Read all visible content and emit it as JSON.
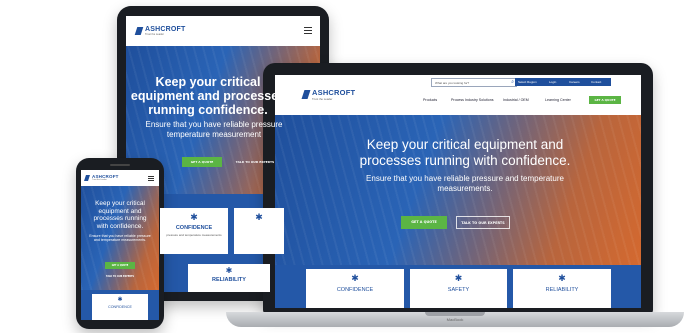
{
  "brand": {
    "name": "ASHCROFT",
    "tagline": "Trust the Leader"
  },
  "hero": {
    "headline_desktop": "Keep your critical equipment and processes running with confidence.",
    "headline_tablet": "Keep your critical equipment and processes running confidence.",
    "subhead_desktop": "Ensure that you have reliable pressure and temperature measurements.",
    "subhead_tablet": "Ensure that you have reliable pressure temperature measurement",
    "headline_phone": "Keep your critical equipment and processes running with confidence.",
    "subhead_phone": "Ensure that you have reliable pressure and temperature measurements."
  },
  "buttons": {
    "quote": "GET A QUOTE",
    "experts": "TALK TO OUR EXPERTS"
  },
  "search": {
    "placeholder": "What are you looking for?"
  },
  "utility_nav": [
    "Select Region",
    "Login",
    "Careers",
    "Contact"
  ],
  "main_nav": [
    "Products",
    "Process Industry Solutions",
    "Industrial / OEM",
    "Learning Center"
  ],
  "cards": [
    {
      "label": "CONFIDENCE",
      "icon": "gear-icon"
    },
    {
      "label": "SAFETY",
      "icon": "gear-icon"
    },
    {
      "label": "RELIABILITY",
      "icon": "gear-icon"
    }
  ],
  "tablet_card_text": "pressure and temperature measurements",
  "laptop_label": "MacBook",
  "colors": {
    "brand_blue": "#1f4f9c",
    "accent_orange": "#d4692f",
    "cta_green": "#5bb544"
  }
}
